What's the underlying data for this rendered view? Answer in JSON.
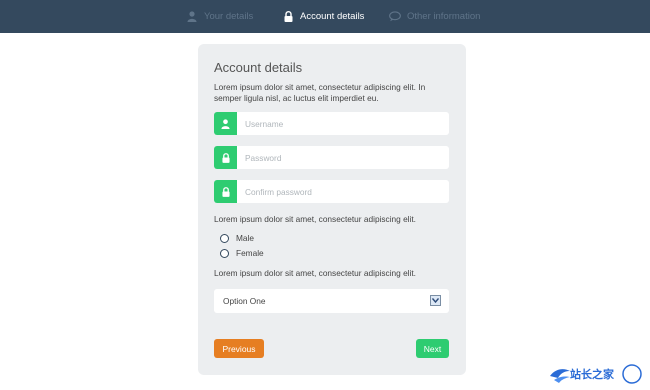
{
  "steps": [
    {
      "label": "Your details",
      "icon": "user-icon",
      "state": "inactive"
    },
    {
      "label": "Account details",
      "icon": "lock-icon",
      "state": "active"
    },
    {
      "label": "Other information",
      "icon": "chat-icon",
      "state": "inactive"
    }
  ],
  "card": {
    "title": "Account details",
    "intro": "Lorem ipsum dolor sit amet, consectetur adipiscing elit. In semper ligula nisl, ac luctus elit imperdiet eu.",
    "fields": [
      {
        "placeholder": "Username",
        "icon": "user-icon",
        "value": ""
      },
      {
        "placeholder": "Password",
        "icon": "lock-icon",
        "value": ""
      },
      {
        "placeholder": "Confirm password",
        "icon": "lock-icon",
        "value": ""
      }
    ],
    "gender_text": "Lorem ipsum dolor sit amet, consectetur adipiscing elit.",
    "radios": [
      {
        "label": "Male",
        "checked": false
      },
      {
        "label": "Female",
        "checked": false
      }
    ],
    "select_text": "Lorem ipsum dolor sit amet, consectetur adipiscing elit.",
    "select_value": "Option One",
    "previous_label": "Previous",
    "next_label": "Next"
  },
  "watermark": {
    "text": "站长之家"
  },
  "colors": {
    "topbar": "#34495e",
    "accent_green": "#2ecc71",
    "accent_orange": "#e67e22",
    "card_bg": "#eceef0"
  }
}
